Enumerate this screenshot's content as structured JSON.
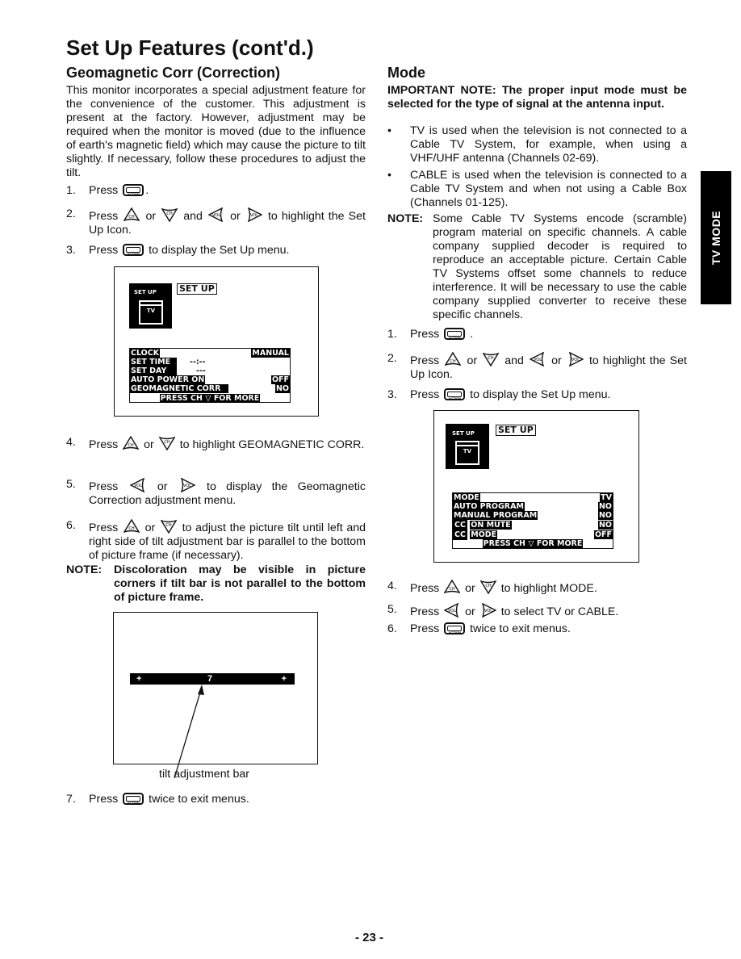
{
  "page": {
    "title": "Set Up Features (cont'd.)",
    "page_number": "- 23 -",
    "side_tab": "TV MODE"
  },
  "icons": {
    "action": "ACTION",
    "ch_up": "CH",
    "ch_down": "CH",
    "vol_left": "VOL",
    "vol_right": "VOL"
  },
  "geomagnetic": {
    "heading": "Geomagnetic Corr (Correction)",
    "intro": "This monitor incorporates a special adjustment feature for the convenience of the customer. This adjustment is present at the factory. However, adjustment may be required when the monitor is moved (due to the influence of earth's magnetic field) which may cause the picture to tilt slightly. If necessary, follow these procedures to adjust the tilt.",
    "steps": [
      {
        "num": "1.",
        "pre": "Press",
        "post": "."
      },
      {
        "num": "2.",
        "pre": "Press",
        "or1": "or",
        "and": "and",
        "or2": "or",
        "post": "to highlight the Set Up Icon."
      },
      {
        "num": "3.",
        "pre": "Press",
        "post": "to display the Set Up menu."
      },
      {
        "num": "4.",
        "pre": "Press",
        "or": "or",
        "post": "to highlight GEOMAGNETIC CORR."
      },
      {
        "num": "5.",
        "pre": "Press",
        "or": "or",
        "post": "to display the Geomagnetic Correction adjustment menu."
      },
      {
        "num": "6.",
        "pre": "Press",
        "or": "or",
        "post": "to adjust the picture tilt until left and right side of tilt adjustment bar is parallel to the bottom of picture frame (if necessary)."
      },
      {
        "num": "7.",
        "pre": "Press",
        "post": "twice to exit menus."
      }
    ],
    "note_label": "NOTE:",
    "note_text": "Discoloration may be visible in picture corners if tilt bar is not parallel to the bottom of picture frame.",
    "osd": {
      "icon_label": "SET UP",
      "icon_sub": "TV",
      "header": "SET UP",
      "rows": [
        {
          "label": "CLOCK",
          "value": "MANUAL"
        },
        {
          "label": "SET TIME",
          "value": "--:--"
        },
        {
          "label": "SET DAY",
          "value": "---"
        },
        {
          "label": "AUTO POWER ON",
          "value": "OFF"
        },
        {
          "label": "GEOMAGNETIC CORR",
          "value": "NO"
        }
      ],
      "footer": "PRESS CH ▽ FOR MORE"
    },
    "tilt": {
      "left_marker": "+",
      "value": "7",
      "right_marker": "+",
      "caption": "tilt adjustment bar"
    }
  },
  "mode": {
    "heading": "Mode",
    "important": "IMPORTANT NOTE: The proper input mode must be selected for the type of signal at the antenna input.",
    "bullets": [
      "TV is used when the television is not connected to a Cable TV System, for example, when using a VHF/UHF antenna (Channels 02-69).",
      "CABLE is used when the television is connected to a Cable TV System and when not using a Cable Box (Channels 01-125)."
    ],
    "note_label": "NOTE:",
    "note_text": "Some Cable TV Systems encode (scramble) program material on specific channels. A cable company supplied decoder is required to reproduce an acceptable picture. Certain Cable TV Systems offset some channels to reduce interference. It will be necessary to use the cable company supplied converter to receive these specific channels.",
    "steps": [
      {
        "num": "1.",
        "pre": "Press",
        "post": "."
      },
      {
        "num": "2.",
        "pre": "Press",
        "or1": "or",
        "and": "and",
        "or2": "or",
        "post": "to highlight the Set Up Icon."
      },
      {
        "num": "3.",
        "pre": "Press",
        "post": "to display the Set Up menu."
      },
      {
        "num": "4.",
        "pre": "Press",
        "or": "or",
        "post": "to highlight MODE."
      },
      {
        "num": "5.",
        "pre": "Press",
        "or": "or",
        "post": "to select TV or CABLE."
      },
      {
        "num": "6.",
        "pre": "Press",
        "post": "twice to exit menus."
      }
    ],
    "osd": {
      "icon_label": "SET UP",
      "icon_sub": "TV",
      "header": "SET UP",
      "rows": [
        {
          "label": "MODE",
          "value": "TV"
        },
        {
          "label": "AUTO PROGRAM",
          "value": "NO"
        },
        {
          "label": "MANUAL PROGRAM",
          "value": "NO"
        },
        {
          "prefix": "CC",
          "label": "ON MUTE",
          "value": "NO"
        },
        {
          "prefix": "CC",
          "label": "MODE",
          "value": "OFF"
        }
      ],
      "footer": "PRESS CH ▽ FOR MORE"
    }
  }
}
